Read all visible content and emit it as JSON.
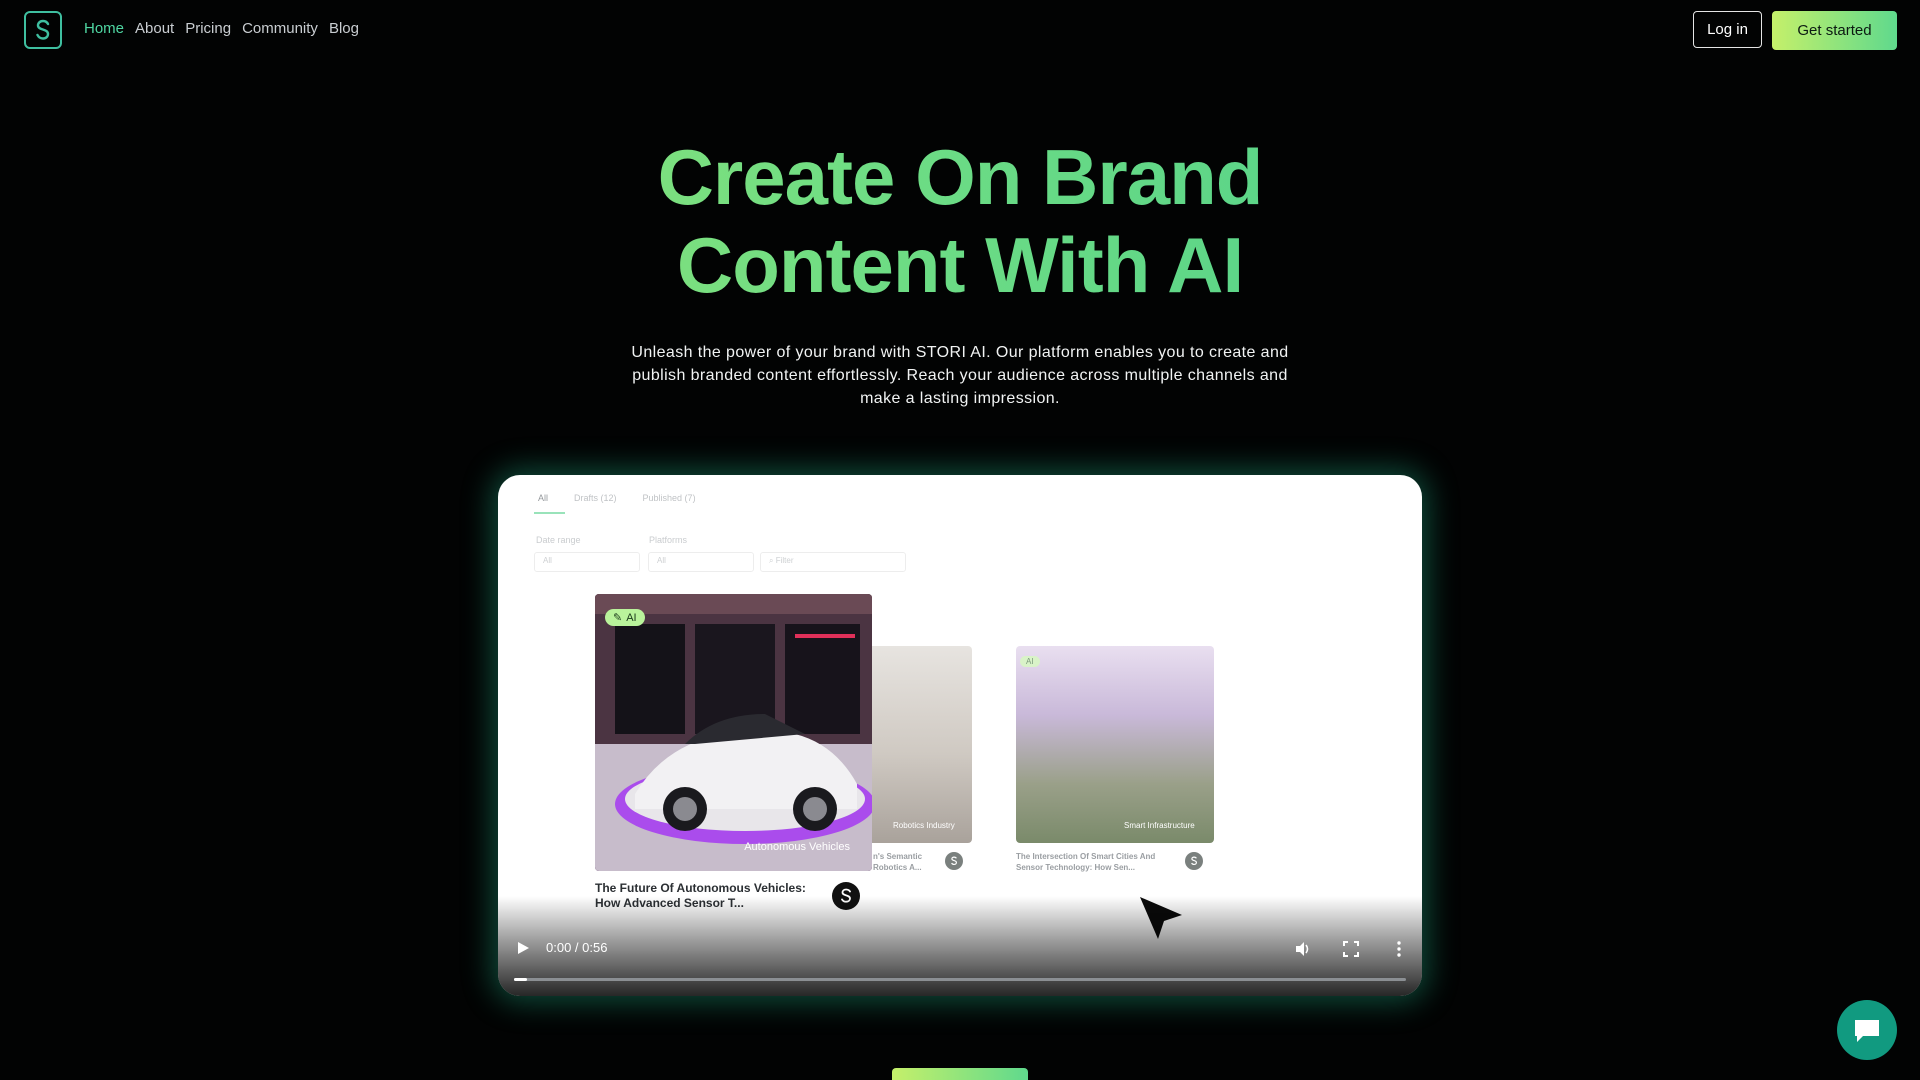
{
  "nav": {
    "links": [
      "Home",
      "About",
      "Pricing",
      "Community",
      "Blog"
    ],
    "active": "Home",
    "login_label": "Log in",
    "start_label": "Get started"
  },
  "hero": {
    "title_line1": "Create On Brand",
    "title_line2": "Content With AI",
    "subtitle": "Unleash the power of your brand with STORI AI. Our platform enables you to create and publish branded content effortlessly. Reach your audience across multiple channels and make a lasting impression."
  },
  "demo": {
    "tabs": [
      "All",
      "Drafts (12)",
      "Published (7)"
    ],
    "filters": {
      "date_label": "Date range",
      "date_value": "All",
      "platforms_label": "Platforms",
      "platforms_value": "All",
      "search_placeholder": "Filter"
    },
    "cards": [
      {
        "badge": "AI",
        "label": "Autonomous Vehicles",
        "caption": "The Future Of Autonomous Vehicles: How Advanced Sensor T..."
      },
      {
        "label": "Robotics Industry",
        "caption": "n's Semantic Robotics A..."
      },
      {
        "badge": "AI",
        "label": "Smart Infrastructure",
        "caption": "The Intersection Of Smart Cities And Sensor Technology: How Sen..."
      }
    ]
  },
  "video": {
    "time": "0:00 / 0:56",
    "progress": 0.015
  },
  "colors": {
    "accent": "#4fd6a2",
    "gradient_start": "#c5f06a",
    "gradient_end": "#5fd98d",
    "chat": "#119a80"
  },
  "icons": [
    "logo-icon",
    "play-icon",
    "volume-icon",
    "fullscreen-icon",
    "more-icon",
    "chat-icon",
    "wand-icon",
    "cursor-icon"
  ]
}
